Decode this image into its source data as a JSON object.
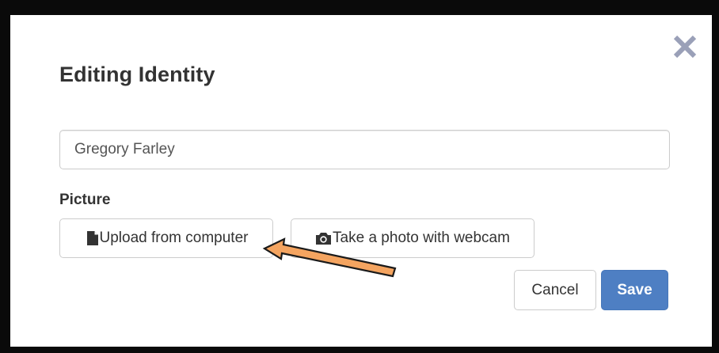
{
  "dialog": {
    "title": "Editing Identity",
    "close_icon": "close-x-icon"
  },
  "form": {
    "name_value": "Gregory Farley",
    "picture_label": "Picture",
    "upload_label": "Upload from computer",
    "upload_icon": "file-icon",
    "webcam_label": "Take a photo with webcam",
    "webcam_icon": "camera-icon"
  },
  "footer": {
    "cancel_label": "Cancel",
    "save_label": "Save"
  },
  "colors": {
    "primary": "#4e7fc3",
    "annotation_arrow": "#f4a460",
    "close_icon": "#9aa0b8",
    "text": "#333333"
  }
}
